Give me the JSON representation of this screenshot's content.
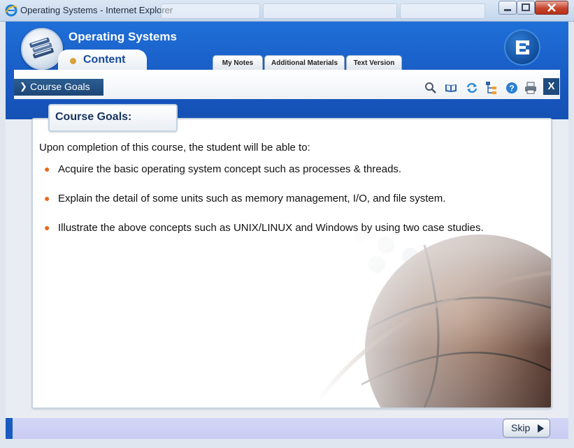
{
  "window": {
    "title": "Operating Systems - Internet Explorer",
    "controls": [
      "minimize",
      "maximize",
      "close"
    ]
  },
  "header": {
    "course_title": "Operating Systems",
    "active_tab": "Content",
    "tabs": [
      {
        "label": "My Notes"
      },
      {
        "label": "Additional Materials"
      },
      {
        "label": "Text Version"
      }
    ]
  },
  "toolbar": {
    "breadcrumb": "Course Goals",
    "icons": [
      "search-icon",
      "book-icon",
      "refresh-icon",
      "sitemap-icon",
      "help-icon",
      "print-icon"
    ],
    "close_label": "X"
  },
  "content": {
    "heading": "Course Goals:",
    "intro": "Upon completion of this course, the student will be able to:",
    "goals": [
      "Acquire the basic operating system concept such as processes & threads.",
      "Explain the detail of some units such as memory management, I/O, and file system.",
      "Illustrate the above concepts such as UNIX/LINUX and Windows by using two case studies."
    ]
  },
  "footer": {
    "skip_label": "Skip"
  },
  "colors": {
    "header_blue": "#1757c0",
    "accent_orange": "#e76a1a",
    "breadcrumb_navy": "#1c4676"
  }
}
